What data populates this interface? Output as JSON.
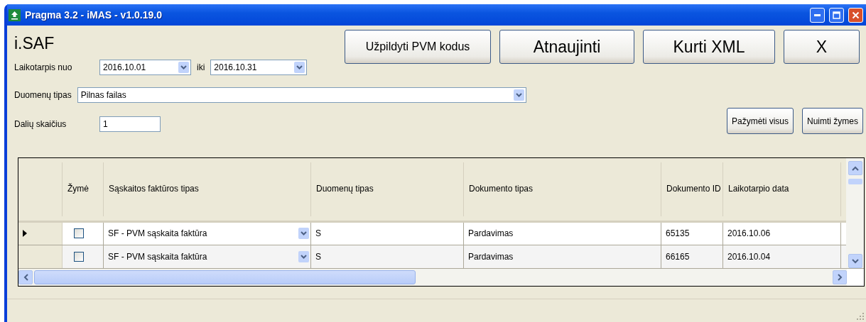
{
  "window": {
    "title": "Pragma 3.2 - iMAS - v1.0.19.0"
  },
  "heading": "i.SAF",
  "period": {
    "from_label": "Laikotarpis nuo",
    "from": "2016.10.01",
    "to_label": "iki",
    "to": "2016.10.31"
  },
  "data_type": {
    "label": "Duomenų tipas",
    "value": "Pilnas failas"
  },
  "parts": {
    "label": "Dalių skaičius",
    "value": "1"
  },
  "actions": [
    "Užpildyti PVM kodus",
    "Atnaujinti",
    "Kurti XML",
    "X"
  ],
  "mark_buttons": [
    "Pažymėti visus",
    "Nuimti žymes"
  ],
  "table": {
    "columns": [
      "Žymė",
      "Sąskaitos faktūros tipas",
      "Duomenų tipas",
      "Dokumento tipas",
      "Dokumento ID",
      "Laikotarpio data"
    ],
    "rows": [
      {
        "current": true,
        "checked": false,
        "invoice_type": "SF - PVM sąskaita faktūra",
        "data_type": "S",
        "document_type": "Pardavimas",
        "document_id": "65135",
        "period_date": "2016.10.06"
      },
      {
        "current": false,
        "checked": false,
        "invoice_type": "SF - PVM sąskaita faktūra",
        "data_type": "S",
        "document_type": "Pardavimas",
        "document_id": "66165",
        "period_date": "2016.10.04"
      }
    ]
  }
}
